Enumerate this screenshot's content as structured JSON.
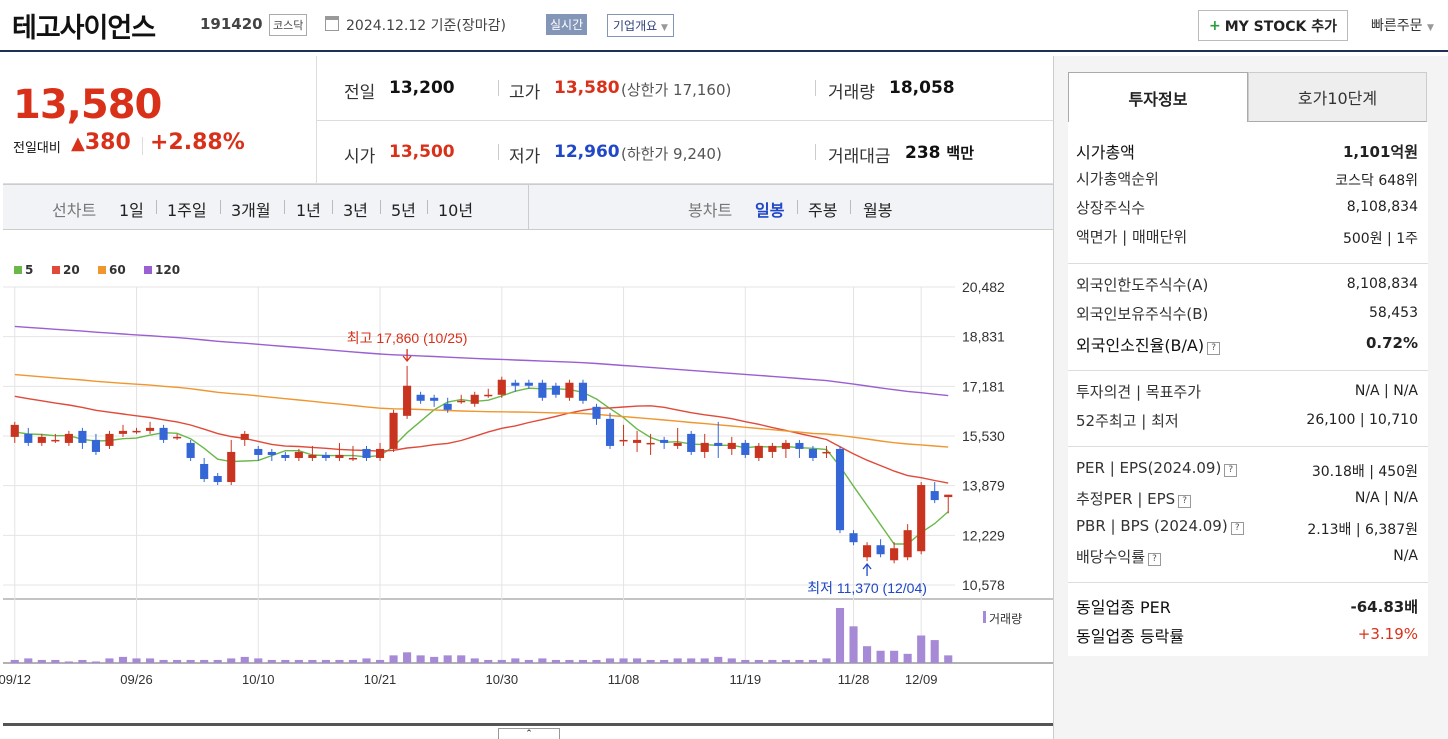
{
  "header": {
    "stock_name": "테고사이언스",
    "stock_code": "191420",
    "market": "코스닥",
    "date": "2024.12.12 기준(장마감)",
    "realtime_label": "실시간",
    "corp_overview_label": "기업개요",
    "mystock_label": "MY STOCK 추가",
    "quick_order_label": "빠른주문"
  },
  "quote": {
    "price": "13,580",
    "change_label": "전일대비",
    "change_amount": "380",
    "change_percent": "+2.88%",
    "prev_close_label": "전일",
    "prev_close": "13,200",
    "high_label": "고가",
    "high": "13,580",
    "upper_limit": "(상한가 17,160)",
    "volume_label": "거래량",
    "volume": "18,058",
    "open_label": "시가",
    "open": "13,500",
    "low_label": "저가",
    "low": "12,960",
    "lower_limit": "(하한가 9,240)",
    "value_label": "거래대금",
    "value": "238",
    "value_unit": "백만"
  },
  "tabs": {
    "line_chart_label": "선차트",
    "periods": [
      "1일",
      "1주일",
      "3개월",
      "1년",
      "3년",
      "5년",
      "10년"
    ],
    "candle_label": "봉차트",
    "candle_types": [
      "일봉",
      "주봉",
      "월봉"
    ],
    "selected_candle": "일봉"
  },
  "chart_data": {
    "type": "candlestick",
    "legend": [
      {
        "name": "5",
        "color": "#6ab84a"
      },
      {
        "name": "20",
        "color": "#e04a3a"
      },
      {
        "name": "60",
        "color": "#f0962e"
      },
      {
        "name": "120",
        "color": "#9a5fd0"
      }
    ],
    "y_ticks": [
      "20,482",
      "18,831",
      "17,181",
      "15,530",
      "13,879",
      "12,229",
      "10,578"
    ],
    "ylim": [
      10578,
      20482
    ],
    "x_ticks": [
      "09/12",
      "09/26",
      "10/10",
      "10/21",
      "10/30",
      "11/08",
      "11/19",
      "11/28",
      "12/09"
    ],
    "annotations": {
      "high": "최고 17,860 (10/25)",
      "low": "최저 11,370 (12/04)"
    },
    "volume_label": "거래량",
    "candles": [
      [
        15500,
        15900,
        16000,
        15300
      ],
      [
        15600,
        15300,
        15800,
        15200
      ],
      [
        15300,
        15500,
        15600,
        15200
      ],
      [
        15400,
        15400,
        15600,
        15300
      ],
      [
        15300,
        15600,
        15700,
        15200
      ],
      [
        15700,
        15300,
        15800,
        15100
      ],
      [
        15400,
        15000,
        15600,
        14900
      ],
      [
        15200,
        15600,
        15700,
        15100
      ],
      [
        15600,
        15700,
        15900,
        15500
      ],
      [
        15700,
        15700,
        15800,
        15600
      ],
      [
        15700,
        15800,
        16000,
        15600
      ],
      [
        15800,
        15400,
        15900,
        15300
      ],
      [
        15500,
        15500,
        15600,
        15400
      ],
      [
        15300,
        14800,
        15400,
        14700
      ],
      [
        14600,
        14100,
        14800,
        14000
      ],
      [
        14200,
        14000,
        14300,
        13900
      ],
      [
        14000,
        15000,
        15400,
        13900
      ],
      [
        15400,
        15600,
        15700,
        15200
      ],
      [
        15100,
        14900,
        15200,
        14700
      ],
      [
        15000,
        14900,
        15100,
        14700
      ],
      [
        14900,
        14800,
        15000,
        14700
      ],
      [
        14800,
        15000,
        15100,
        14700
      ],
      [
        14800,
        14900,
        15200,
        14700
      ],
      [
        14900,
        14800,
        15000,
        14700
      ],
      [
        14800,
        14900,
        15300,
        14700
      ],
      [
        14800,
        14800,
        15200,
        14700
      ],
      [
        15100,
        14800,
        15200,
        14700
      ],
      [
        14800,
        15100,
        15300,
        14700
      ],
      [
        15100,
        16300,
        16400,
        15000
      ],
      [
        16200,
        17200,
        17860,
        16100
      ],
      [
        16900,
        16700,
        17000,
        16600
      ],
      [
        16800,
        16700,
        16900,
        16500
      ],
      [
        16600,
        16400,
        16800,
        16300
      ],
      [
        16700,
        16700,
        16900,
        16600
      ],
      [
        16600,
        16900,
        17000,
        16500
      ],
      [
        16900,
        16900,
        17100,
        16800
      ],
      [
        16900,
        17400,
        17500,
        16800
      ],
      [
        17300,
        17200,
        17400,
        17000
      ],
      [
        17300,
        17200,
        17400,
        17100
      ],
      [
        17300,
        16800,
        17400,
        16700
      ],
      [
        17200,
        16900,
        17300,
        16800
      ],
      [
        16800,
        17300,
        17400,
        16700
      ],
      [
        17300,
        16700,
        17400,
        16600
      ],
      [
        16500,
        16100,
        16600,
        15900
      ],
      [
        16100,
        15200,
        16300,
        15100
      ],
      [
        15400,
        15400,
        15900,
        15200
      ],
      [
        15300,
        15400,
        15700,
        15000
      ],
      [
        15300,
        15300,
        15600,
        14900
      ],
      [
        15400,
        15300,
        15500,
        15100
      ],
      [
        15200,
        15300,
        15800,
        15100
      ],
      [
        15600,
        15000,
        15700,
        14900
      ],
      [
        15000,
        15300,
        15600,
        14800
      ],
      [
        15300,
        15200,
        16000,
        14800
      ],
      [
        15100,
        15300,
        15500,
        14900
      ],
      [
        15300,
        14900,
        15400,
        14800
      ],
      [
        14800,
        15200,
        15300,
        14700
      ],
      [
        15000,
        15200,
        15300,
        14800
      ],
      [
        15100,
        15300,
        15400,
        14800
      ],
      [
        15300,
        15100,
        15400,
        14800
      ],
      [
        15100,
        14800,
        15200,
        14700
      ],
      [
        15000,
        15000,
        15200,
        14800
      ],
      [
        15100,
        12400,
        15200,
        12300
      ],
      [
        12300,
        12000,
        12400,
        11900
      ],
      [
        11500,
        11900,
        12000,
        11370
      ],
      [
        11900,
        11600,
        12100,
        11500
      ],
      [
        11400,
        11800,
        12000,
        11300
      ],
      [
        11500,
        12400,
        12600,
        11400
      ],
      [
        11700,
        13900,
        14000,
        11600
      ],
      [
        13700,
        13400,
        14000,
        13300
      ],
      [
        13500,
        13580,
        13580,
        12960
      ]
    ],
    "volumes": [
      2,
      3,
      2,
      2,
      1,
      2,
      1,
      3,
      4,
      3,
      3,
      2,
      2,
      2,
      2,
      2,
      3,
      4,
      3,
      2,
      2,
      2,
      2,
      2,
      2,
      2,
      3,
      2,
      5,
      7,
      5,
      4,
      5,
      5,
      3,
      2,
      2,
      3,
      2,
      3,
      2,
      2,
      2,
      2,
      3,
      3,
      3,
      2,
      2,
      3,
      3,
      3,
      4,
      3,
      2,
      2,
      2,
      2,
      2,
      2,
      3,
      36,
      24,
      11,
      8,
      8,
      6,
      18,
      15,
      5
    ]
  },
  "right_panel": {
    "tabs": [
      "투자정보",
      "호가10단계"
    ],
    "rows1": [
      {
        "label": "시가총액",
        "value": "1,101억원"
      },
      {
        "label": "시가총액순위",
        "value": "코스닥 648위"
      },
      {
        "label": "상장주식수",
        "value": "8,108,834"
      },
      {
        "label": "액면가 | 매매단위",
        "value": "500원 | 1주"
      }
    ],
    "rows2": [
      {
        "label": "외국인한도주식수(A)",
        "value": "8,108,834"
      },
      {
        "label": "외국인보유주식수(B)",
        "value": "58,453"
      },
      {
        "label": "외국인소진율(B/A)",
        "value": "0.72%"
      }
    ],
    "rows3": [
      {
        "label": "투자의견 | 목표주가",
        "value": "N/A | N/A"
      },
      {
        "label": "52주최고 | 최저",
        "value": "26,100 | 10,710"
      }
    ],
    "rows4": [
      {
        "label": "PER | EPS(2024.09)",
        "value": "30.18배 | 450원"
      },
      {
        "label": "추정PER | EPS",
        "value": "N/A | N/A"
      },
      {
        "label": "PBR | BPS (2024.09)",
        "value": "2.13배 | 6,387원"
      },
      {
        "label": "배당수익률",
        "value": "N/A"
      }
    ],
    "rows5": [
      {
        "label": "동일업종 PER",
        "value": "-64.83배"
      },
      {
        "label": "동일업종 등락률",
        "value": "+3.19%"
      }
    ]
  }
}
